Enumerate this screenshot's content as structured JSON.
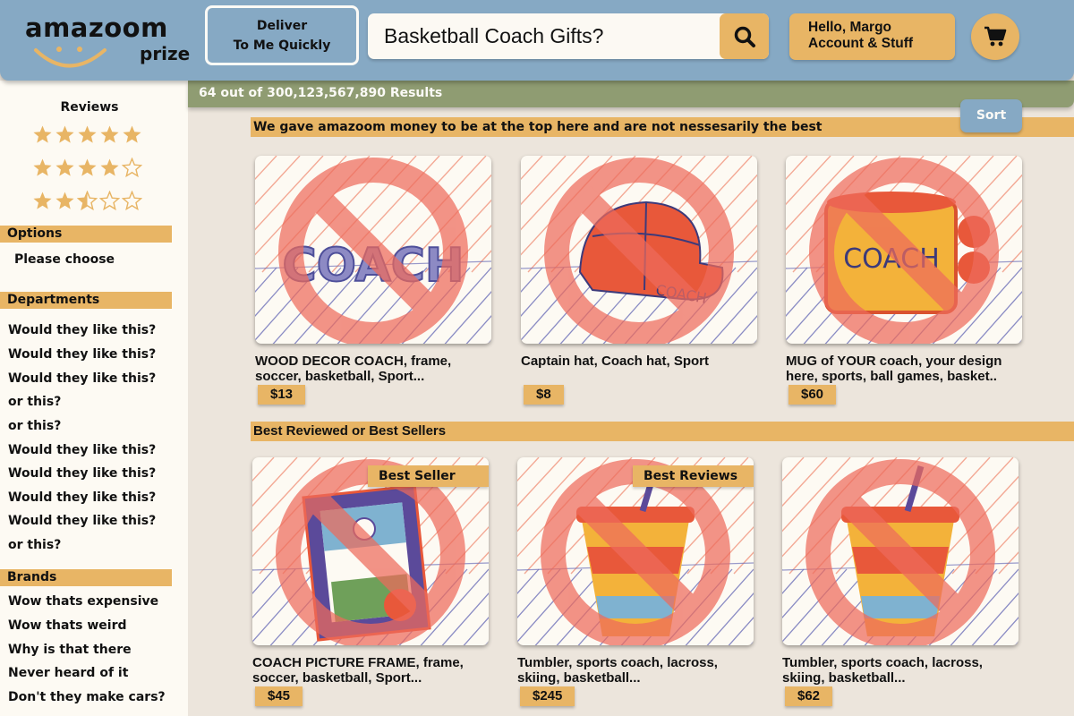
{
  "header": {
    "logo_word": "amazoom",
    "logo_sub": "prize",
    "deliver_line1": "Deliver",
    "deliver_line2": "To Me Quickly",
    "search_value": "Basketball Coach Gifts?",
    "search_icon": "search-icon",
    "account_line1": "Hello, Margo",
    "account_line2": "Account & Stuff",
    "cart_icon": "shopping-cart-icon"
  },
  "results": {
    "text": "64 out of 300,123,567,890 Results"
  },
  "sort": {
    "label": "Sort"
  },
  "sidebar": {
    "reviews_title": "Reviews",
    "rating_filters": [
      {
        "rating": 5,
        "max": 5
      },
      {
        "rating": 4,
        "max": 5
      },
      {
        "rating": 2.5,
        "max": 5
      }
    ],
    "options_header": "Options",
    "options_item": "Please choose",
    "departments_header": "Departments",
    "departments": [
      "Would they like this?",
      "Would they like this?",
      "Would they like this?",
      "or this?",
      "or this?",
      "Would they like this?",
      "Would they like this?",
      "Would they like this?",
      "Would they like this?",
      "or this?"
    ],
    "brands_header": "Brands",
    "brands": [
      "Wow thats expensive",
      "Wow thats weird",
      "Why is that there",
      "Never heard of it",
      "Don't they make cars?"
    ]
  },
  "sections": {
    "sponsored_title": "We gave amazoom money to be at the top here and are not nessesarily the best",
    "best_title": "Best Reviewed or Best Sellers"
  },
  "products": [
    {
      "title": "WOOD DECOR COACH, frame, soccer, basketball, Sport...",
      "price": "$13",
      "badge": "",
      "image": "coach-lettering"
    },
    {
      "title": "Captain hat, Coach hat, Sport",
      "price": "$8",
      "badge": "",
      "image": "coach-cap"
    },
    {
      "title": "MUG of YOUR coach, your design here, sports, ball games, basket..",
      "price": "$60",
      "badge": "",
      "image": "coach-mug"
    },
    {
      "title": "COACH PICTURE FRAME, frame, soccer, basketball, Sport...",
      "price": "$45",
      "badge": "Best Seller",
      "image": "picture-frame"
    },
    {
      "title": "Tumbler, sports coach, lacross, skiing, basketball...",
      "price": "$245",
      "badge": "Best Reviews",
      "image": "tumbler"
    },
    {
      "title": "Tumbler, sports coach, lacross, skiing, basketball...",
      "price": "$62",
      "badge": "",
      "image": "tumbler"
    }
  ],
  "colors": {
    "header_blue": "#86a9c4",
    "accent_orange": "#e8b565",
    "results_green": "#8f9c72",
    "prohibited_red": "#ee6b5c"
  }
}
